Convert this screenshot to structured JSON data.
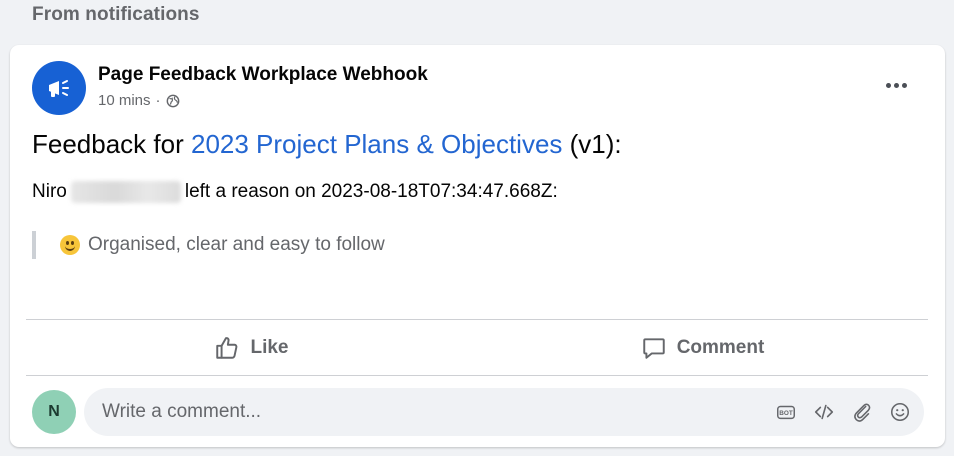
{
  "section": {
    "title": "From notifications"
  },
  "post": {
    "author": "Page Feedback Workplace Webhook",
    "time": "10 mins",
    "meta_separator": "·",
    "title_prefix": "Feedback for ",
    "title_link": "2023 Project Plans & Objectives",
    "title_suffix": " (v1):",
    "reason_first_name": "Niro",
    "reason_text": "left a reason on 2023-08-18T07:34:47.668Z:",
    "quote": "Organised, clear and easy to follow"
  },
  "actions": {
    "like": "Like",
    "comment": "Comment"
  },
  "comment_input": {
    "avatar_initial": "N",
    "placeholder": "Write a comment..."
  },
  "icons": {
    "page_avatar": "megaphone-icon",
    "privacy": "globe-icon",
    "more": "more-horizontal-icon",
    "like": "thumbs-up-icon",
    "comment": "speech-bubble-icon",
    "bot": "bot-icon",
    "code": "code-icon",
    "attach": "paperclip-icon",
    "emoji": "smiley-icon"
  },
  "colors": {
    "link": "#2366d1",
    "page_avatar_bg": "#1761d4",
    "user_avatar_bg": "#8fd0b5",
    "muted_text": "#65676b"
  }
}
